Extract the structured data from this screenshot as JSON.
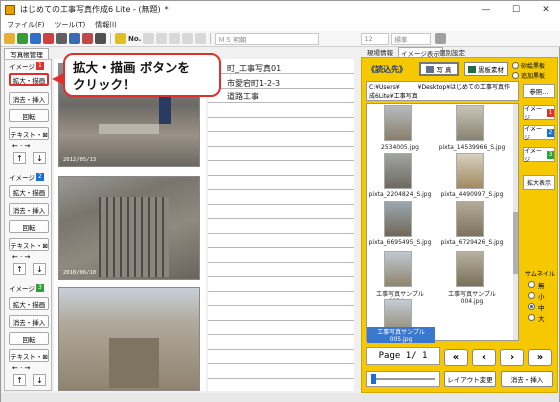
{
  "window": {
    "title": "はじめての工事写真作成6 Lite - (無題)",
    "modified": "*",
    "minimize": "—",
    "maximize": "☐",
    "close": "✕"
  },
  "menu": [
    "ファイル(F)",
    "ツール(T)",
    "情報(I)"
  ],
  "toolbar": {
    "font_name": "ＭＳ 明朝",
    "font_size": "12",
    "style": "標準"
  },
  "left": {
    "tab": "写真帳管理",
    "groups": [
      {
        "label": "イメージ",
        "num": "1",
        "btn_draw": "拡大・描画",
        "btn_delete": "消去・挿入",
        "btn_rotate": "回転",
        "btn_text": "テキスト・⊠"
      },
      {
        "label": "イメージ",
        "num": "2",
        "btn_draw": "拡大・描画",
        "btn_delete": "消去・挿入",
        "btn_rotate": "回転",
        "btn_text": "テキスト・⊠"
      },
      {
        "label": "イメージ",
        "num": "3",
        "btn_draw": "拡大・描画",
        "btn_delete": "消去・挿入",
        "btn_rotate": "回転",
        "btn_text": "テキスト・⊠"
      }
    ]
  },
  "photos": {
    "stamp1": "2012/05/13",
    "stamp2": "2010/06/10"
  },
  "text": {
    "line1": "町_工事写真01",
    "line2": "市愛宕町1-2-3",
    "line3": "道路工事"
  },
  "right": {
    "tabs": [
      "現場情報",
      "イメージ表示",
      "個別設定"
    ],
    "read_label": "《読込先》",
    "btn_photo": "写 真",
    "btn_blackboard": "黒板素材",
    "check1": "砂絵黒板",
    "check2": "追加黒板",
    "path": "C:¥Users¥　　　¥Desktop¥はじめての工事写真作成6Lite¥工事写真",
    "browse": "参照...",
    "side_image1": "イメージ",
    "side_num1": "1",
    "side_image2": "イメージ",
    "side_num2": "2",
    "side_image3": "イメージ",
    "side_num3": "3",
    "zoom_display": "拡大表示",
    "thumb_size_label": "サムネイル",
    "thumb_sizes": [
      "無",
      "小",
      "中",
      "大"
    ],
    "captions": [
      "2534005.jpg",
      "pixta_14539966_S.jpg",
      "pixta_2204824_S.jpg",
      "pixta_4490997_S.jpg",
      "pixta_6695495_S.jpg",
      "pixta_6729426_S.jpg",
      "工事写真サンプル003.jpg",
      "工事写真サンプル004.jpg",
      "工事写真サンプル005.jpg"
    ],
    "page_text": "Page 1/ 1",
    "btn_first": "«",
    "btn_prev": "‹",
    "btn_next": "›",
    "btn_last": "»",
    "layout_change": "レイアウト変更",
    "delete_insert": "消去・挿入"
  },
  "callout": {
    "line1": "拡大・描画 ボタンを",
    "line2": "クリック！"
  },
  "colors": {
    "accent": "#e0302b",
    "panel": "#f5c800",
    "num1": "#e0302b",
    "num2": "#1a6fd0",
    "num3": "#2ea03a"
  }
}
